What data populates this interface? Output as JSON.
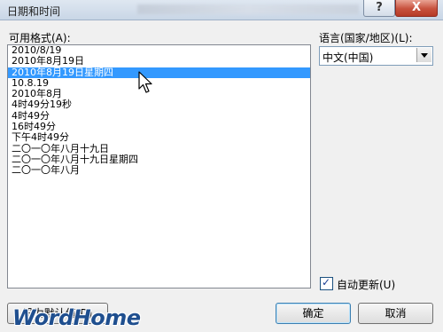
{
  "window": {
    "title": "日期和时间",
    "help_label": "?",
    "close_label": "X"
  },
  "formats": {
    "label": "可用格式(A):",
    "items": [
      "2010/8/19",
      "2010年8月19日",
      "2010年8月19日星期四",
      "10.8.19",
      "2010年8月",
      "4时49分19秒",
      "4时49分",
      "16时49分",
      "下午4时49分",
      "二〇一〇年八月十九日",
      "二〇一〇年八月十九日星期四",
      "二〇一〇年八月"
    ],
    "selected_index": 2
  },
  "language": {
    "label": "语言(国家/地区)(L):",
    "value": "中文(中国)"
  },
  "auto_update": {
    "label": "自动更新(U)",
    "checked": true,
    "check_glyph": "✓"
  },
  "buttons": {
    "set_default": "设为默认值(D)",
    "ok": "确定",
    "cancel": "取消"
  },
  "watermark": "WordHome",
  "colors": {
    "selection": "#3399ff",
    "watermark": "#1f4f8f"
  }
}
